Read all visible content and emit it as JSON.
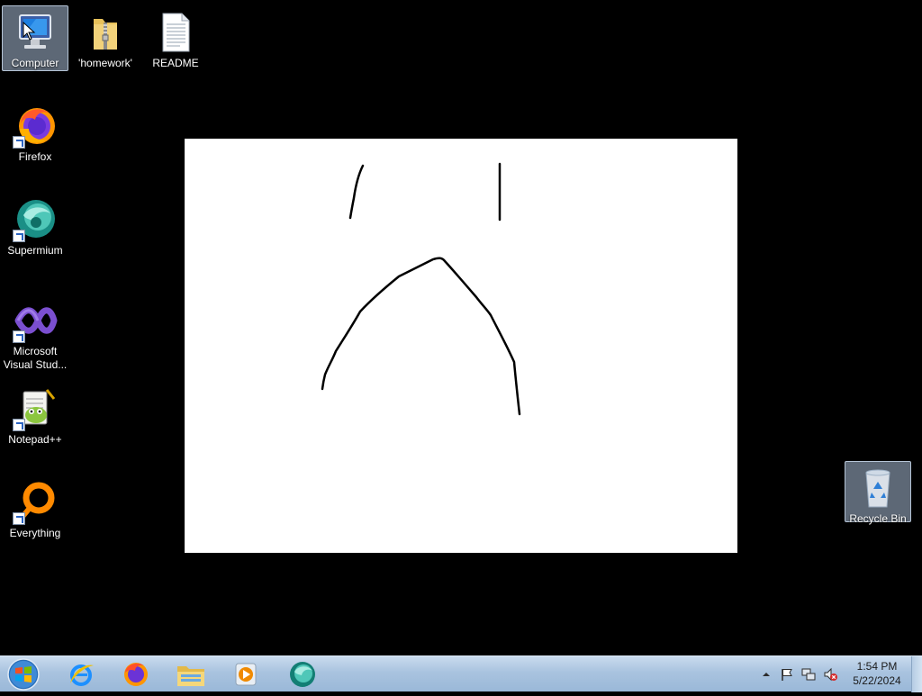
{
  "desktop": {
    "background_color": "#000000",
    "icons": [
      {
        "label": "Computer",
        "icon": "computer-icon",
        "selected": true
      },
      {
        "label": "'homework'",
        "icon": "zip-folder-icon"
      },
      {
        "label": "README",
        "icon": "text-file-icon"
      },
      {
        "label": "Firefox",
        "icon": "firefox-icon"
      },
      {
        "label": "Supermium",
        "icon": "supermium-icon"
      },
      {
        "label": "Microsoft\nVisual Stud...",
        "icon": "visual-studio-icon"
      },
      {
        "label": "Notepad++",
        "icon": "notepadpp-icon"
      },
      {
        "label": "Everything",
        "icon": "everything-icon"
      },
      {
        "label": "Recycle Bin",
        "icon": "recycle-bin-icon",
        "selected": true
      }
    ]
  },
  "canvas": {
    "background": "#ffffff",
    "stroke_color": "#000000",
    "drawing": "frowning face sketch"
  },
  "taskbar": {
    "start_icon": "windows-logo-icon",
    "pinned": [
      {
        "name": "Internet Explorer",
        "icon": "internet-explorer-icon"
      },
      {
        "name": "Firefox",
        "icon": "firefox-icon"
      },
      {
        "name": "Windows Explorer",
        "icon": "file-explorer-icon"
      },
      {
        "name": "Windows Media Player",
        "icon": "media-player-icon"
      },
      {
        "name": "Supermium",
        "icon": "supermium-icon"
      }
    ],
    "tray_icons": [
      "show-hidden-icons-icon",
      "action-center-flag-icon",
      "network-icon",
      "volume-muted-icon"
    ],
    "clock": {
      "time": "1:54 PM",
      "date": "5/22/2024"
    }
  }
}
